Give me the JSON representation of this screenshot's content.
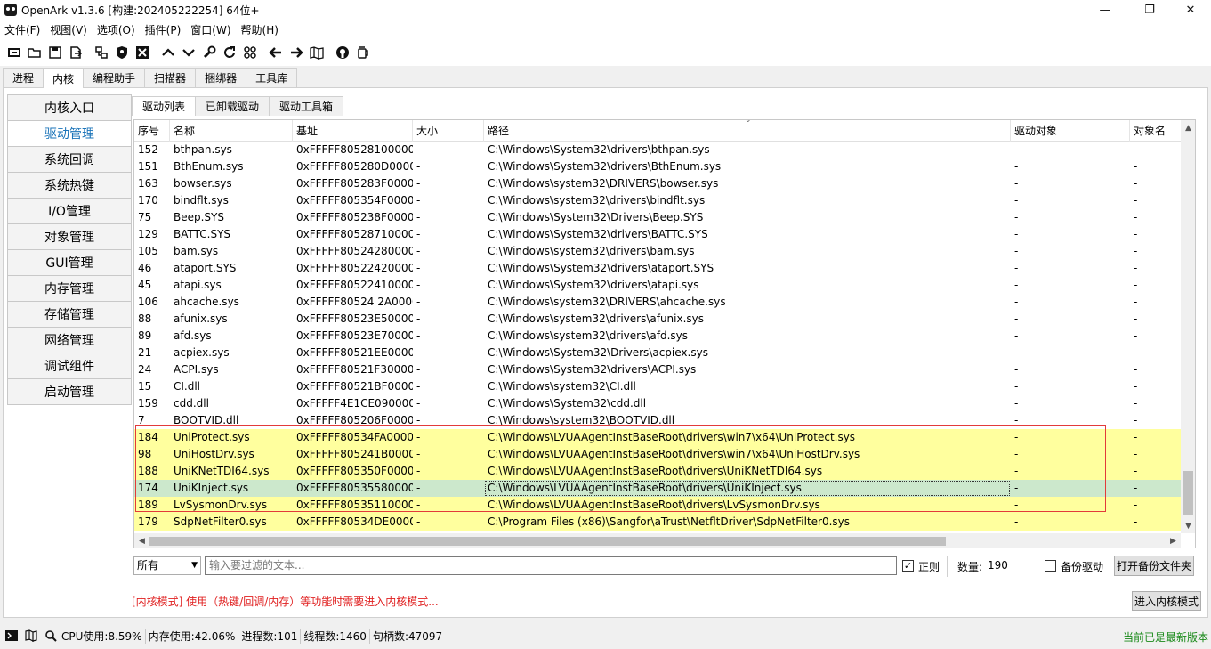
{
  "window": {
    "title": "OpenArk v1.3.6 [构建:202405222254]  64位+",
    "minimize": "—",
    "maximize": "❐",
    "close": "✕"
  },
  "menu": [
    "文件(F)",
    "视图(V)",
    "选项(O)",
    "插件(P)",
    "窗口(W)",
    "帮助(H)"
  ],
  "toolbar_icons": [
    "console-icon",
    "open-folder-icon",
    "save-icon",
    "export-icon",
    "link-icon",
    "shield-icon",
    "close-box-icon",
    "arrow-up-icon",
    "arrow-down-icon",
    "wrench-icon",
    "refresh-icon",
    "grid-icon",
    "arrow-left-icon",
    "arrow-right-icon",
    "map-icon",
    "github-icon",
    "jar-icon"
  ],
  "main_tabs": [
    "进程",
    "内核",
    "编程助手",
    "扫描器",
    "捆绑器",
    "工具库"
  ],
  "main_tab_active": 1,
  "sidebar": [
    "内核入口",
    "驱动管理",
    "系统回调",
    "系统热键",
    "I/O管理",
    "对象管理",
    "GUI管理",
    "内存管理",
    "存储管理",
    "网络管理",
    "调试组件",
    "启动管理"
  ],
  "sidebar_active": 1,
  "sub_tabs": [
    "驱动列表",
    "已卸载驱动",
    "驱动工具箱"
  ],
  "sub_tab_active": 0,
  "table": {
    "columns": [
      "序号",
      "名称",
      "基址",
      "大小",
      "路径",
      "驱动对象",
      "对象名"
    ],
    "rows": [
      [
        "152",
        "bthpan.sys",
        "0xFFFFF80528100000",
        "-",
        "C:\\Windows\\System32\\drivers\\bthpan.sys",
        "-",
        "-"
      ],
      [
        "151",
        "BthEnum.sys",
        "0xFFFFF805280D0000",
        "-",
        "C:\\Windows\\System32\\drivers\\BthEnum.sys",
        "-",
        "-"
      ],
      [
        "163",
        "bowser.sys",
        "0xFFFFF805283F0000",
        "-",
        "C:\\Windows\\system32\\DRIVERS\\bowser.sys",
        "-",
        "-"
      ],
      [
        "170",
        "bindflt.sys",
        "0xFFFFF805354F0000",
        "-",
        "C:\\Windows\\system32\\drivers\\bindflt.sys",
        "-",
        "-"
      ],
      [
        "75",
        "Beep.SYS",
        "0xFFFFF805238F0000",
        "-",
        "C:\\Windows\\System32\\Drivers\\Beep.SYS",
        "-",
        "-"
      ],
      [
        "129",
        "BATTC.SYS",
        "0xFFFFF80528710000",
        "-",
        "C:\\Windows\\System32\\drivers\\BATTC.SYS",
        "-",
        "-"
      ],
      [
        "105",
        "bam.sys",
        "0xFFFFF80524280000",
        "-",
        "C:\\Windows\\system32\\drivers\\bam.sys",
        "-",
        "-"
      ],
      [
        "46",
        "ataport.SYS",
        "0xFFFFF80522420000",
        "-",
        "C:\\Windows\\System32\\drivers\\ataport.SYS",
        "-",
        "-"
      ],
      [
        "45",
        "atapi.sys",
        "0xFFFFF80522410000",
        "-",
        "C:\\Windows\\System32\\drivers\\atapi.sys",
        "-",
        "-"
      ],
      [
        "106",
        "ahcache.sys",
        "0xFFFFF80524 2A0000",
        "-",
        "C:\\Windows\\system32\\DRIVERS\\ahcache.sys",
        "-",
        "-"
      ],
      [
        "88",
        "afunix.sys",
        "0xFFFFF80523E50000",
        "-",
        "C:\\Windows\\system32\\drivers\\afunix.sys",
        "-",
        "-"
      ],
      [
        "89",
        "afd.sys",
        "0xFFFFF80523E70000",
        "-",
        "C:\\Windows\\system32\\drivers\\afd.sys",
        "-",
        "-"
      ],
      [
        "21",
        "acpiex.sys",
        "0xFFFFF80521EE0000",
        "-",
        "C:\\Windows\\System32\\Drivers\\acpiex.sys",
        "-",
        "-"
      ],
      [
        "24",
        "ACPI.sys",
        "0xFFFFF80521F30000",
        "-",
        "C:\\Windows\\System32\\drivers\\ACPI.sys",
        "-",
        "-"
      ],
      [
        "15",
        "CI.dll",
        "0xFFFFF80521BF0000",
        "-",
        "C:\\Windows\\system32\\CI.dll",
        "-",
        "-"
      ],
      [
        "159",
        "cdd.dll",
        "0xFFFFF4E1CE090000",
        "-",
        "C:\\Windows\\System32\\cdd.dll",
        "-",
        "-"
      ],
      [
        "7",
        "BOOTVID.dll",
        "0xFFFFF805206F0000",
        "-",
        "C:\\Windows\\system32\\BOOTVID.dll",
        "-",
        "-"
      ],
      [
        "184",
        "UniProtect.sys",
        "0xFFFFF80534FA0000",
        "-",
        "C:\\Windows\\LVUAAgentInstBaseRoot\\drivers\\win7\\x64\\UniProtect.sys",
        "-",
        "-"
      ],
      [
        "98",
        "UniHostDrv.sys",
        "0xFFFFF805241B0000",
        "-",
        "C:\\Windows\\LVUAAgentInstBaseRoot\\drivers\\win7\\x64\\UniHostDrv.sys",
        "-",
        "-"
      ],
      [
        "188",
        "UniKNetTDI64.sys",
        "0xFFFFF805350F0000",
        "-",
        "C:\\Windows\\LVUAAgentInstBaseRoot\\drivers\\UniKNetTDI64.sys",
        "-",
        "-"
      ],
      [
        "174",
        "UniKInject.sys",
        "0xFFFFF80535580000",
        "-",
        "C:\\Windows\\LVUAAgentInstBaseRoot\\drivers\\UniKInject.sys",
        "-",
        "-"
      ],
      [
        "189",
        "LvSysmonDrv.sys",
        "0xFFFFF80535110000",
        "-",
        "C:\\Windows\\LVUAAgentInstBaseRoot\\drivers\\LvSysmonDrv.sys",
        "-",
        "-"
      ],
      [
        "179",
        "SdpNetFilter0.sys",
        "0xFFFFF80534DE0000",
        "-",
        "C:\\Program Files (x86)\\Sangfor\\aTrust\\NetfltDriver\\SdpNetFilter0.sys",
        "-",
        "-"
      ]
    ],
    "highlight_rows": [
      17,
      18,
      19,
      21,
      22
    ],
    "selected_row": 20,
    "highlight_color": "#ffff9e",
    "selected_color": "#cce8cc",
    "sort_caret": "⌄"
  },
  "filter": {
    "scope": "所有",
    "placeholder": "输入要过滤的文本...",
    "regex_label": "正则",
    "regex_checked": "✓",
    "count_label": "数量:",
    "count_value": "190",
    "backup_label": "备份驱动",
    "open_backup_button": "打开备份文件夹"
  },
  "kernel_msg": "[内核模式] 使用（热键/回调/内存）等功能时需要进入内核模式...",
  "enter_kernel_button": "进入内核模式",
  "status": {
    "cpu": "CPU使用:8.59%",
    "mem": "内存使用:42.06%",
    "procs": "进程数:101",
    "threads": "线程数:1460",
    "handles": "句柄数:47097",
    "latest": "当前已是最新版本"
  },
  "colors": {
    "accent": "#1a73b8",
    "warning": "#e02020",
    "ok": "#1a8a1a",
    "annotation": "#e23a3a"
  }
}
